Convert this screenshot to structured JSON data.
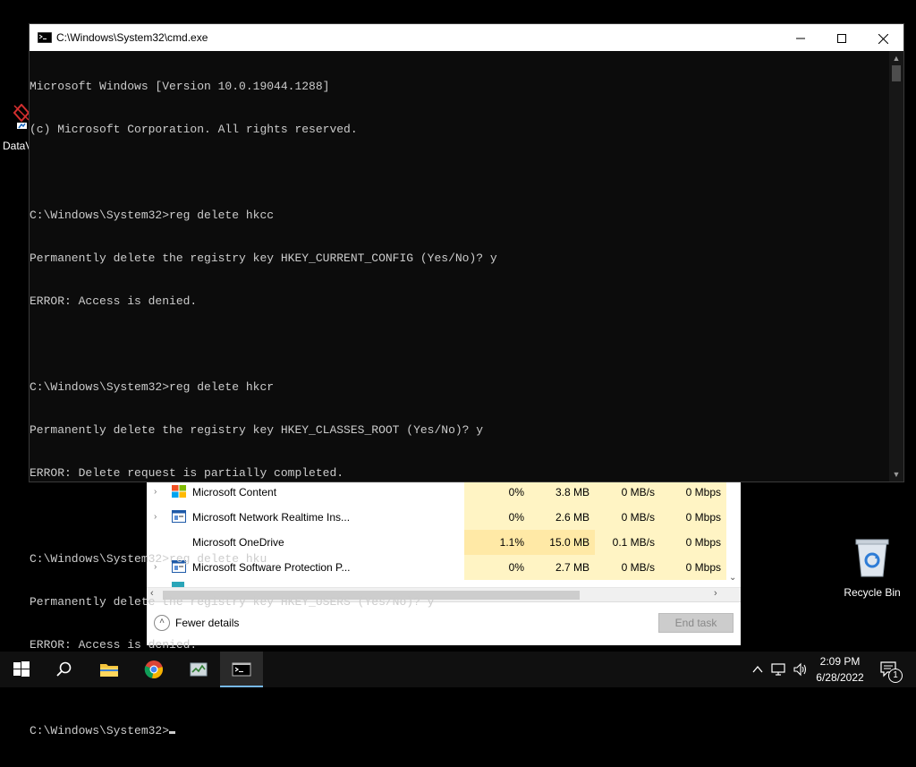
{
  "desktop": {
    "partial_icon_label": "DataV",
    "recycle_bin_label": "Recycle Bin"
  },
  "cmd_window": {
    "title": "C:\\Windows\\System32\\cmd.exe",
    "lines": [
      "Microsoft Windows [Version 10.0.19044.1288]",
      "(c) Microsoft Corporation. All rights reserved.",
      "",
      "C:\\Windows\\System32>reg delete hkcc",
      "Permanently delete the registry key HKEY_CURRENT_CONFIG (Yes/No)? y",
      "ERROR: Access is denied.",
      "",
      "C:\\Windows\\System32>reg delete hkcr",
      "Permanently delete the registry key HKEY_CLASSES_ROOT (Yes/No)? y",
      "ERROR: Delete request is partially completed.",
      "",
      "C:\\Windows\\System32>reg delete hku",
      "Permanently delete the registry key HKEY_USERS (Yes/No)? y",
      "ERROR: Access is denied.",
      ""
    ],
    "prompt": "C:\\Windows\\System32>"
  },
  "task_manager": {
    "rows": [
      {
        "name": "Microsoft Content",
        "cpu": "0%",
        "memory": "3.8 MB",
        "disk": "0 MB/s",
        "network": "0 Mbps",
        "expandable": true,
        "icon": "colored-tiles-icon"
      },
      {
        "name": "Microsoft Network Realtime Ins...",
        "cpu": "0%",
        "memory": "2.6 MB",
        "disk": "0 MB/s",
        "network": "0 Mbps",
        "expandable": true,
        "icon": "service-window-icon"
      },
      {
        "name": "Microsoft OneDrive",
        "cpu": "1.1%",
        "memory": "15.0 MB",
        "disk": "0.1 MB/s",
        "network": "0 Mbps",
        "expandable": false,
        "icon": "none"
      },
      {
        "name": "Microsoft Software Protection P...",
        "cpu": "0%",
        "memory": "2.7 MB",
        "disk": "0 MB/s",
        "network": "0 Mbps",
        "expandable": true,
        "icon": "service-window-icon"
      }
    ],
    "fewer_details_label": "Fewer details",
    "end_task_label": "End task"
  },
  "taskbar": {
    "time": "2:09 PM",
    "date": "6/28/2022",
    "notification_count": "1"
  },
  "colors": {
    "console_bg": "#0c0c0c",
    "console_text": "#cccccc",
    "taskbar_bg": "#101010",
    "tm_heat": "#fff4c4",
    "accent": "#76b9ed"
  }
}
